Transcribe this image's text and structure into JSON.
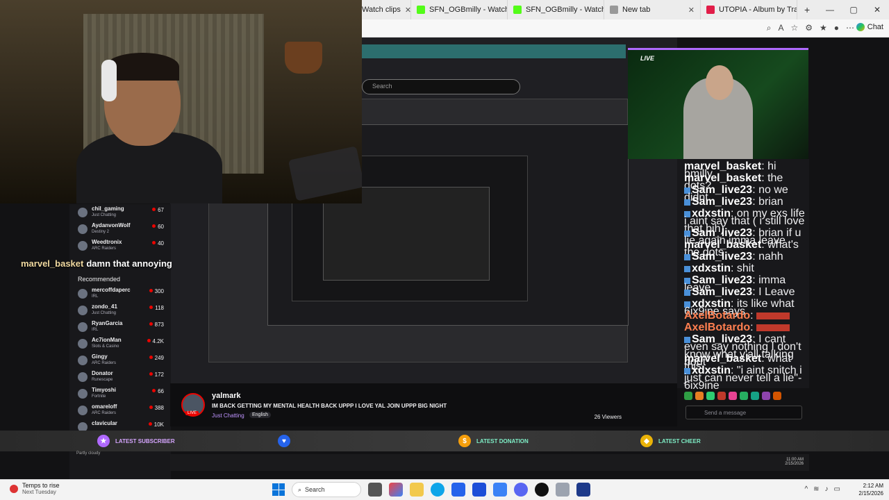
{
  "browser": {
    "tabs": [
      {
        "title": "Watch clips",
        "color": "#53fc18"
      },
      {
        "title": "SFN_OGBmilly - Watch clips",
        "color": "#53fc18"
      },
      {
        "title": "SFN_OGBmilly - Watch clips",
        "color": "#53fc18"
      },
      {
        "title": "New tab",
        "color": "#999999"
      },
      {
        "title": "UTOPIA - Album by Travis Sc",
        "color": "#e11d48"
      }
    ],
    "new_tab": "+",
    "copilot_label": "Chat",
    "window_controls": {
      "minimize": "—",
      "maximize": "▢",
      "close": "✕"
    }
  },
  "stream": {
    "search_placeholder": "Search",
    "live_label": "LIVE",
    "overlay_chat": {
      "user": "marvel_basket",
      "text": "damn that annoying"
    },
    "recommended_header": "Recommended",
    "followed": [
      {
        "name": "chil_gaming",
        "game": "Just Chatting",
        "viewers": "67"
      },
      {
        "name": "AydanvonWolf",
        "game": "Destiny 2",
        "viewers": "60"
      },
      {
        "name": "Weedtronix",
        "game": "ARC Raiders",
        "viewers": "40"
      }
    ],
    "recommended": [
      {
        "name": "mercoffdaperc",
        "game": "IRL",
        "viewers": "300"
      },
      {
        "name": "zondo_41",
        "game": "Just Chatting",
        "viewers": "118"
      },
      {
        "name": "RyanGarcia",
        "game": "IRL",
        "viewers": "873"
      },
      {
        "name": "Ac7ionMan",
        "game": "Slots & Casino",
        "viewers": "4.2K"
      },
      {
        "name": "Gingy",
        "game": "ARC Raiders",
        "viewers": "249"
      },
      {
        "name": "Donator",
        "game": "Runescape",
        "viewers": "172"
      },
      {
        "name": "Timyoshi",
        "game": "Fortnite",
        "viewers": "66"
      },
      {
        "name": "omareloff",
        "game": "ARC Raiders",
        "viewers": "388"
      },
      {
        "name": "clavicular",
        "game": "",
        "viewers": "10K"
      }
    ],
    "chat": [
      {
        "user": "marvel_basket",
        "text": "hi bmilly",
        "badge": false
      },
      {
        "user": "marvel_basket",
        "text": "the dots?",
        "badge": false
      },
      {
        "user": "Sam_live23",
        "text": "no we didnt",
        "badge": true
      },
      {
        "user": "Sam_live23",
        "text": "brian",
        "badge": true
      },
      {
        "user": "xdxstin",
        "text": "on my exs life i aint say that ( i still love that bih)",
        "badge": true
      },
      {
        "user": "Sam_live23",
        "text": "brian if u lie again imma leave",
        "badge": true
      },
      {
        "user": "marvel_basket",
        "text": "what's the dots",
        "badge": false
      },
      {
        "user": "Sam_live23",
        "text": "nahh",
        "badge": true
      },
      {
        "user": "xdxstin",
        "text": "shit",
        "badge": true
      },
      {
        "user": "Sam_live23",
        "text": "imma leave",
        "badge": true
      },
      {
        "user": "Sam_live23",
        "text": "I Leave",
        "badge": true
      },
      {
        "user": "xdxstin",
        "text": "its like what 6ix9ine says",
        "badge": true
      },
      {
        "user": "AxelBotardo",
        "text": "",
        "badge": false
      },
      {
        "user": "AxelBotardo",
        "text": "",
        "badge": false
      },
      {
        "user": "Sam_live23",
        "text": "I cant even say nothing I don't know what y'all talking bout",
        "badge": true
      },
      {
        "user": "marvel_basket",
        "text": "what this ...",
        "badge": false
      },
      {
        "user": "xdxstin",
        "text": "\"i aint snitch i just can never tell a lie\"- 6ix9ine",
        "badge": true
      }
    ],
    "send_placeholder": "Send a message",
    "streamer": {
      "name": "yalmark",
      "title": "IM BACK GETTING MY MENTAL HEALTH BACK UPPP I LOVE YAL JOIN UPPP BIG NIGHT",
      "category": "Just Chatting",
      "language": "English",
      "viewers": "26 Viewers",
      "live_tag": "LIVE"
    },
    "alerts": {
      "subscriber": "LATEST SUBSCRIBER",
      "donation": "LATEST DONATION",
      "cheer": "LATEST CHEER"
    },
    "inner_clock": {
      "time": "11:00 AM",
      "date": "2/15/2026"
    },
    "inner_weather": "Partly cloudy"
  },
  "taskbar": {
    "weather_title": "Temps to rise",
    "weather_sub": "Next Tuesday",
    "search_label": "Search",
    "time": "2:12 AM",
    "date": "2/15/2026"
  }
}
